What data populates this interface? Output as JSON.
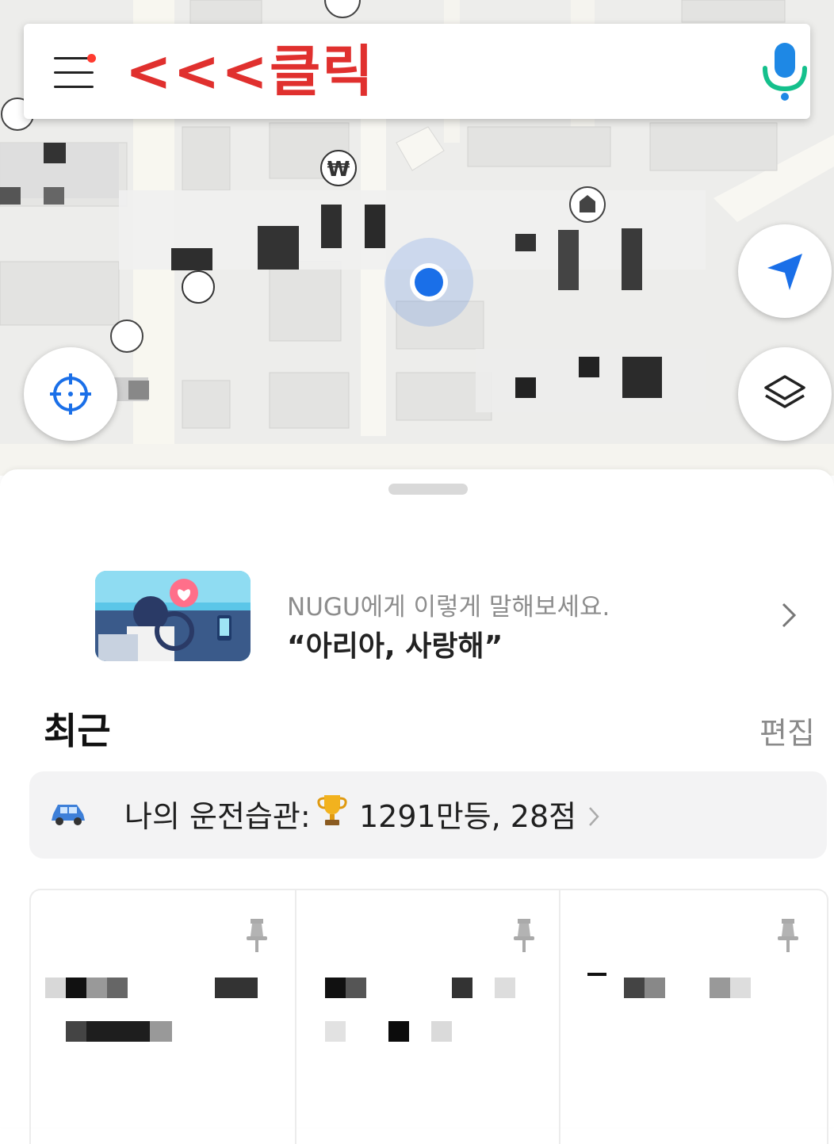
{
  "search_bar": {
    "annotation": "<<<클릭",
    "menu_icon": "hamburger-menu-icon",
    "mic_icon": "microphone-icon"
  },
  "map": {
    "controls": [
      "navigate-arrow-icon",
      "current-location-crosshair-icon",
      "layers-icon"
    ]
  },
  "promo": {
    "subtitle": "NUGU에게 이렇게 말해보세요.",
    "phrase": "“아리아, 사랑해”"
  },
  "recent": {
    "title": "최근",
    "edit_label": "편집"
  },
  "driving_habit": {
    "label": "나의 운전습관:",
    "value": "1291만등, 28점"
  },
  "colors": {
    "accent_blue": "#1a6fe8",
    "annotation_red": "#e0302e",
    "map_background": "#ededeb",
    "map_road": "#f8f7f2"
  }
}
